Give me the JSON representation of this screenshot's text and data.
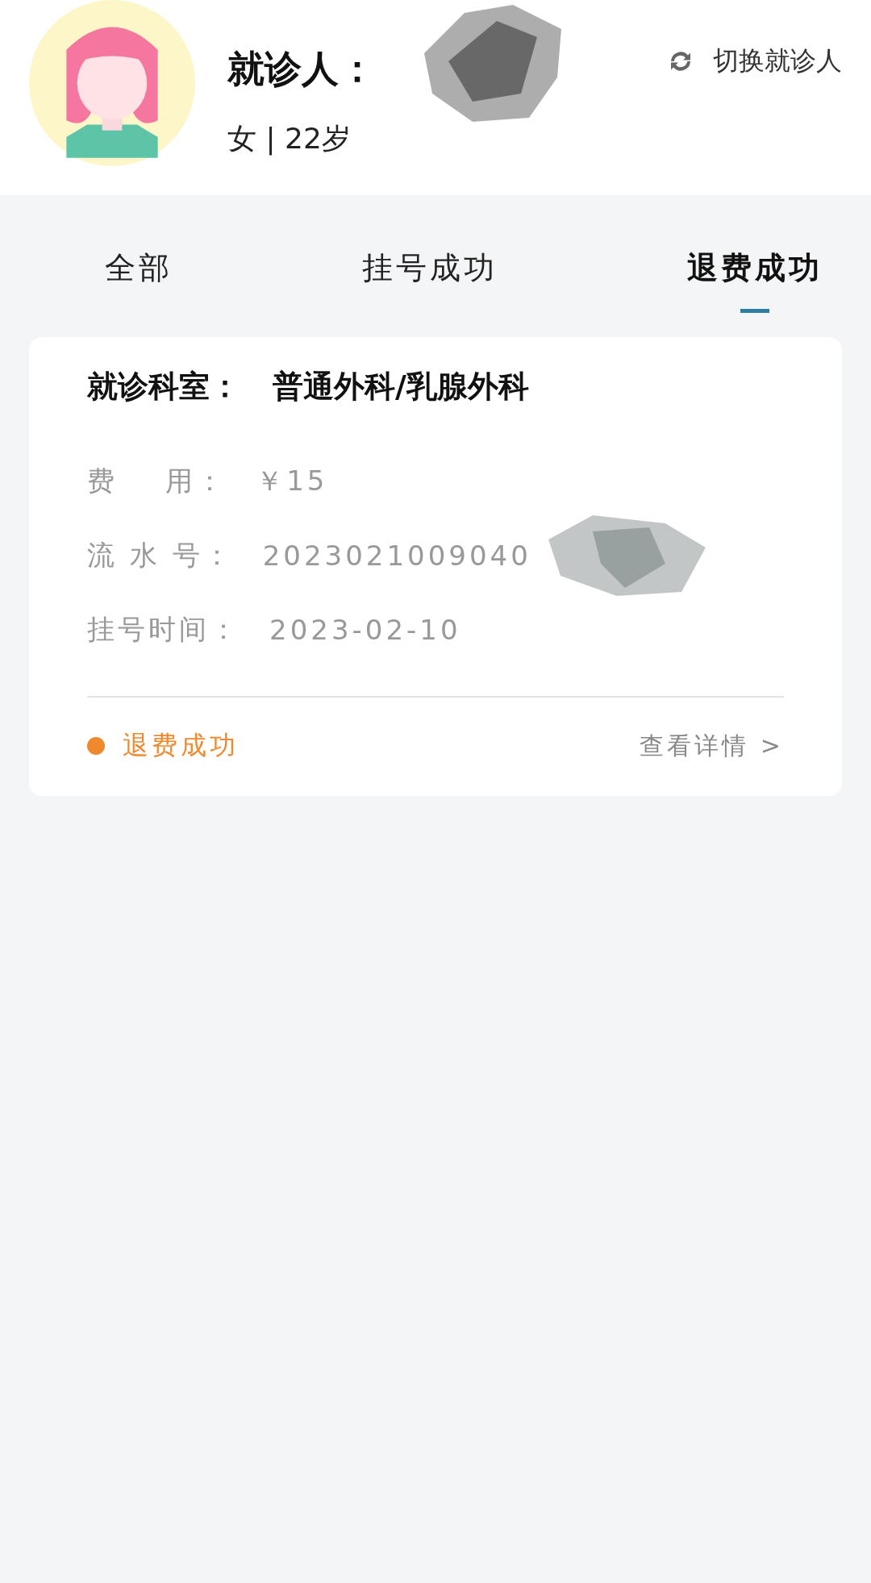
{
  "patient": {
    "label": "就诊人：",
    "info": "女 | 22岁",
    "switch_label": "切换就诊人"
  },
  "tabs": [
    {
      "label": "全部",
      "selected": false
    },
    {
      "label": "挂号成功",
      "selected": false
    },
    {
      "label": "退费成功",
      "selected": true
    }
  ],
  "records": [
    {
      "department_label": "就诊科室：",
      "department": "普通外科/乳腺外科",
      "fields": [
        {
          "label": "费    用：",
          "value": "￥15",
          "redacted": false
        },
        {
          "label": "流 水 号：",
          "value": "2023021009040",
          "redacted": true
        },
        {
          "label": "挂号时间：",
          "value": "2023-02-10",
          "redacted": false
        }
      ],
      "status": "退费成功",
      "color": "#f0882e",
      "details_link": "查看详情 >"
    }
  ]
}
